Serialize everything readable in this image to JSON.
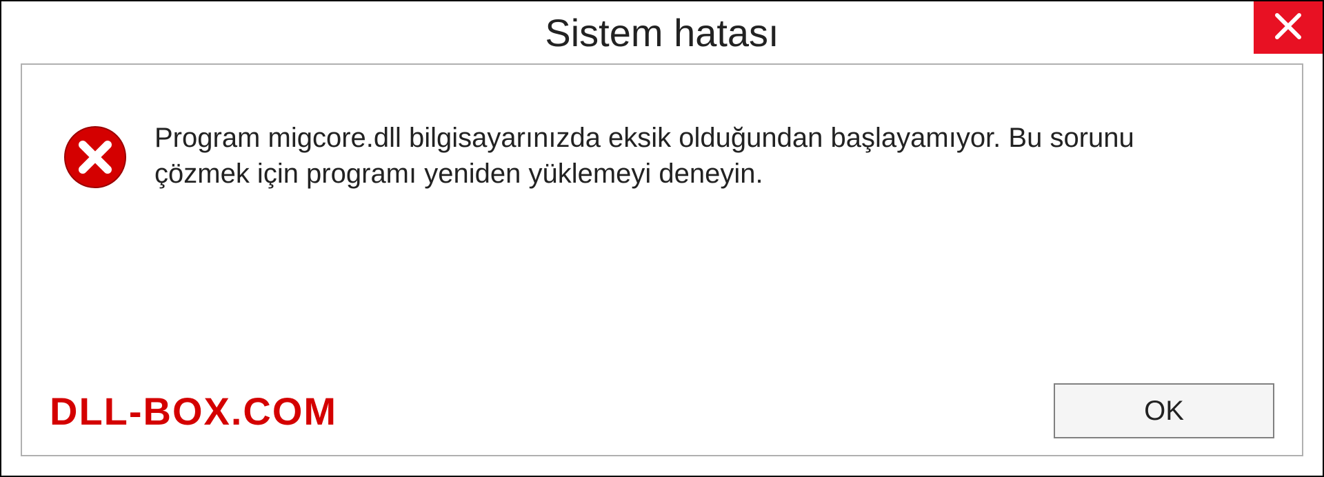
{
  "dialog": {
    "title": "Sistem hatası",
    "message": "Program migcore.dll bilgisayarınızda eksik olduğundan başlayamıyor. Bu sorunu çözmek için programı yeniden yüklemeyi deneyin.",
    "ok_label": "OK",
    "watermark": "DLL-BOX.COM"
  }
}
